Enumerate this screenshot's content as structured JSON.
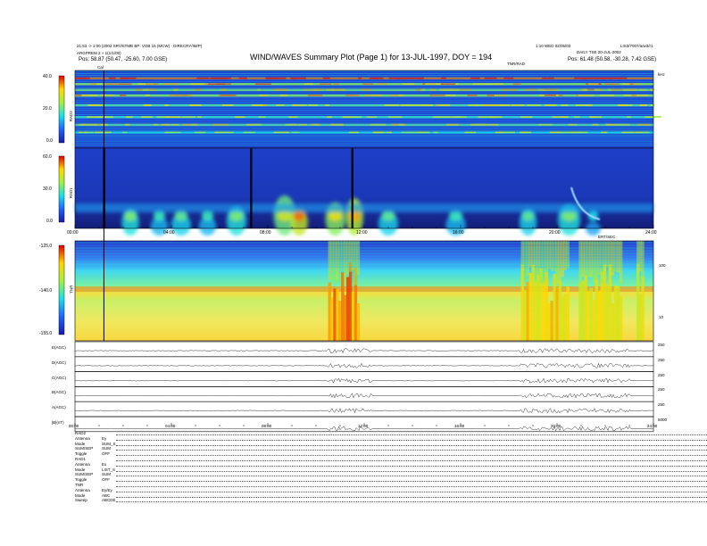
{
  "header": {
    "left_line1": "21:53 -> 1:00 (2003 SRV/6TMB BP: VOB 15 (MCW) - DIRECRY/IM/P)",
    "left_line2": "ARGPREM 2 + 1(1/1/00)",
    "pos_left_label": "Pos:",
    "pos_left_value": "58.87 (50.47, -25.60, 7.00 GSE)",
    "title": "WIND/WAVES Summary Plot (Page 1) for 13-JUL-1997, DOY = 194",
    "right_top_a": "1:10 WED 02/05/03",
    "right_top_b": "LIS3/7007/a/w3/r1",
    "right_line2": "DAILY TSE 20-JUL-2002",
    "pos_right_label": "Pos:",
    "pos_right_value": "61.48 (50.58, -30.28, 7.42 GSE)",
    "cal_label": "Cal",
    "tnr_note": "TNR/RAD",
    "khz_label": "kHz"
  },
  "panels": {
    "rad2": {
      "name": "RAD2",
      "yticks": [
        "40.0",
        "20.0",
        "0.0"
      ]
    },
    "rad1": {
      "name": "RAD1",
      "yticks": [
        "60.0",
        "30.0",
        "0.0"
      ],
      "xticks": [
        "00:00",
        "04:00",
        "08:00",
        "12:00",
        "16:00",
        "20:00",
        "24:00"
      ]
    },
    "tnr": {
      "name": "TNR",
      "yticks": [
        "-125.0",
        "-140.0",
        "-155.0"
      ],
      "right_ticks": [
        "100",
        "10"
      ],
      "corner_label": "ERT/SEC"
    },
    "traces": {
      "labels": [
        "E(AGC)",
        "D(AGC)",
        "C(AGC)",
        "B(AGC)",
        "A(AGC)",
        "|B|(nT)"
      ],
      "right_ticks": [
        "250",
        "250",
        "250",
        "250",
        "250",
        "5000"
      ],
      "xticks": [
        "00:00",
        "04:00",
        "08:00",
        "12:00",
        "16:00",
        "20:00",
        "24:00"
      ]
    }
  },
  "status": [
    {
      "label": "RAD2",
      "value": ""
    },
    {
      "label": "Antenna",
      "value": "Ey"
    },
    {
      "label": "Mode",
      "value": "SUM_S"
    },
    {
      "label": "SUM/SEP",
      "value": "SUM"
    },
    {
      "label": "Toggle",
      "value": "OFF"
    },
    {
      "label": "RAD1",
      "value": ""
    },
    {
      "label": "Antenna",
      "value": "Ex"
    },
    {
      "label": "Mode",
      "value": "LIST_S"
    },
    {
      "label": "SUM/SEP",
      "value": "SUM"
    },
    {
      "label": "Toggle",
      "value": "OFF"
    },
    {
      "label": "TNR",
      "value": ""
    },
    {
      "label": "Antenna",
      "value": "Ey/Ey"
    },
    {
      "label": "Mode",
      "value": "ABC"
    },
    {
      "label": "Sweep",
      "value": "ABCDE"
    }
  ],
  "colors": {
    "spec_low": "#1e3fc8",
    "spec_high": "#e80000",
    "background": "#ffffff"
  },
  "chart_data": {
    "type": "heatmap",
    "title": "WIND/WAVES Summary Plot (Page 1) for 13-JUL-1997, DOY = 194",
    "x": {
      "ticks": [
        "00:00",
        "04:00",
        "08:00",
        "12:00",
        "16:00",
        "20:00",
        "24:00"
      ],
      "range_hours": [
        0,
        24
      ]
    },
    "panels": [
      {
        "name": "RAD2",
        "y_range": [
          0,
          40
        ],
        "y_ticks": [
          0,
          20,
          40
        ],
        "emission_bands": [
          {
            "y": 36.0,
            "level": 0.9
          },
          {
            "y": 33.0,
            "level": 0.6
          },
          {
            "y": 30.0,
            "level": 0.55
          },
          {
            "y": 27.0,
            "level": 0.6
          },
          {
            "y": 22.0,
            "level": 0.5
          },
          {
            "y": 16.0,
            "level": 0.45
          },
          {
            "y": 12.0,
            "level": 0.5
          },
          {
            "y": 8.0,
            "level": 0.4
          }
        ],
        "cal_time_hours": 1.2
      },
      {
        "name": "RAD1",
        "y_range": [
          0,
          60
        ],
        "y_ticks": [
          0,
          30,
          60
        ],
        "bursts": [
          {
            "t": 2.3,
            "width": 0.5,
            "height": 20,
            "level": 0.55
          },
          {
            "t": 3.5,
            "width": 0.5,
            "height": 14,
            "level": 0.45
          },
          {
            "t": 4.4,
            "width": 0.6,
            "height": 16,
            "level": 0.5
          },
          {
            "t": 5.5,
            "width": 0.5,
            "height": 14,
            "level": 0.45
          },
          {
            "t": 6.7,
            "width": 0.6,
            "height": 22,
            "level": 0.55
          },
          {
            "t": 8.7,
            "width": 0.7,
            "height": 30,
            "level": 0.7
          },
          {
            "t": 9.3,
            "width": 0.5,
            "height": 20,
            "level": 0.9
          },
          {
            "t": 10.8,
            "width": 0.6,
            "height": 25,
            "level": 0.75
          },
          {
            "t": 11.6,
            "width": 0.5,
            "height": 28,
            "level": 0.85
          },
          {
            "t": 13.0,
            "width": 0.6,
            "height": 18,
            "level": 0.5
          },
          {
            "t": 15.8,
            "width": 0.6,
            "height": 16,
            "level": 0.45
          },
          {
            "t": 18.8,
            "width": 0.5,
            "height": 20,
            "level": 0.5
          },
          {
            "t": 20.5,
            "width": 0.7,
            "height": 24,
            "level": 0.55
          },
          {
            "t": 21.5,
            "width": 0.4,
            "height": 10,
            "level": 0.4
          }
        ],
        "black_gaps_hours": [
          1.2,
          7.3,
          11.5
        ],
        "cal_time_hours": 1.2
      },
      {
        "name": "TNR",
        "y_range": [
          -155,
          -125
        ],
        "y_ticks": [
          -155,
          -140,
          -125
        ],
        "plasma_line_level": -140,
        "storm_intervals": [
          {
            "start": 10.5,
            "end": 11.8,
            "level": 0.95
          },
          {
            "start": 18.5,
            "end": 20.5,
            "level": 0.85
          },
          {
            "start": 20.9,
            "end": 22.7,
            "level": 0.8
          },
          {
            "start": 23.3,
            "end": 23.6,
            "level": 0.8
          }
        ],
        "cal_time_hours": 1.2
      }
    ],
    "traces": {
      "labels": [
        "E(AGC)",
        "D(AGC)",
        "C(AGC)",
        "B(AGC)",
        "A(AGC)",
        "|B|(nT)"
      ],
      "active_intervals": [
        [
          10.5,
          12.3
        ],
        [
          18.5,
          23.0
        ]
      ]
    }
  }
}
